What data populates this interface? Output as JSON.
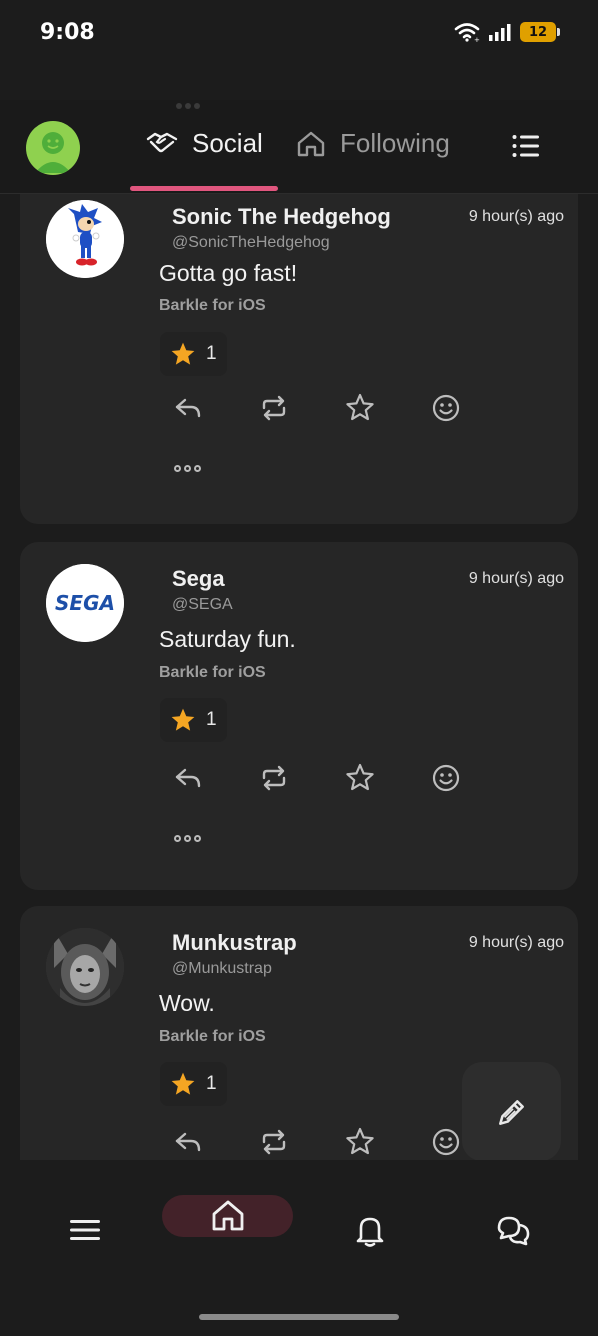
{
  "status_bar": {
    "time": "9:08",
    "battery": "12"
  },
  "header": {
    "tabs": [
      {
        "label": "Social",
        "icon": "handshake-icon",
        "active": true
      },
      {
        "label": "Following",
        "icon": "home-outline-icon",
        "active": false
      }
    ]
  },
  "posts": [
    {
      "name": "Sonic The Hedgehog",
      "handle": "@SonicTheHedgehog",
      "time": "9 hour(s) ago",
      "text": "Gotta go fast!",
      "source": "Barkle for iOS",
      "reaction": {
        "emoji": "star",
        "count": "1"
      }
    },
    {
      "name": "Sega",
      "handle": "@SEGA",
      "time": "9 hour(s) ago",
      "text": "Saturday fun.",
      "source": "Barkle for iOS",
      "avatar_text": "SEGA",
      "reaction": {
        "emoji": "star",
        "count": "1"
      }
    },
    {
      "name": "Munkustrap",
      "handle": "@Munkustrap",
      "time": "9 hour(s) ago",
      "text": "Wow.",
      "source": "Barkle for iOS",
      "reaction": {
        "emoji": "star",
        "count": "1"
      }
    }
  ],
  "colors": {
    "accent": "#e0567e",
    "star": "#f5a623",
    "avatar_green": "#8fd14f",
    "sega_blue": "#1d4fa8"
  },
  "bottom_nav": [
    "menu-icon",
    "home-icon",
    "bell-icon",
    "chat-icon"
  ]
}
